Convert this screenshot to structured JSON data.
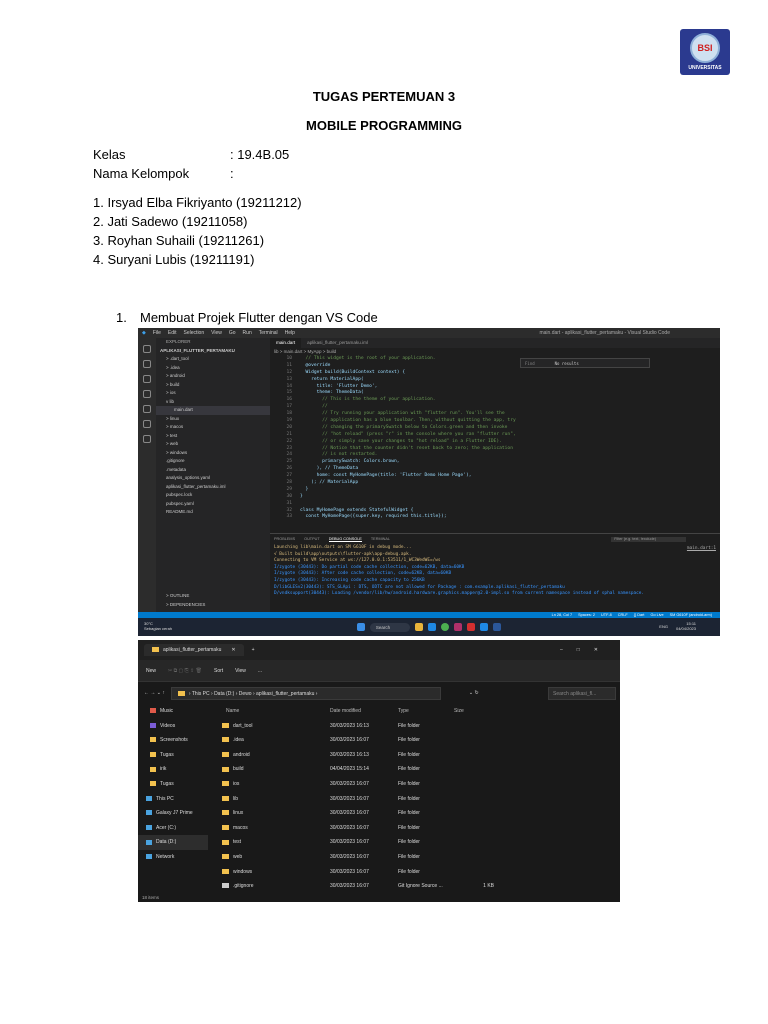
{
  "logo": {
    "text": "UNIVERSITAS",
    "seal": "BSI"
  },
  "header": {
    "title": "TUGAS PERTEMUAN 3",
    "subtitle": "MOBILE PROGRAMMING"
  },
  "info": {
    "kelas_label": "Kelas",
    "kelas_value": ": 19.4B.05",
    "nama_label": "Nama Kelompok",
    "nama_value": ":"
  },
  "members": [
    "1. Irsyad Elba Fikriyanto (19211212)",
    "2. Jati Sadewo (19211058)",
    "3. Royhan Suhaili (19211261)",
    "4. Suryani Lubis (19211191)"
  ],
  "section": {
    "number": "1.",
    "title": "Membuat Projek Flutter dengan VS Code"
  },
  "vscode": {
    "menu": [
      "File",
      "Edit",
      "Selection",
      "View",
      "Go",
      "Run",
      "Terminal",
      "Help"
    ],
    "window_title": "main.dart - aplikasi_flutter_pertamaku - Visual Studio Code",
    "explorer_label": "EXPLORER",
    "project": "APLIKASI_FLUTTER_PERTAMAKU",
    "tree": [
      "> .dart_tool",
      "> .idea",
      "> android",
      "> build",
      "> ios",
      "v lib",
      "main.dart",
      "> linux",
      "> macos",
      "> test",
      "> web",
      "> windows",
      ".gitignore",
      ".metadata",
      "analysis_options.yaml",
      "aplikasi_flutter_pertamaku.iml",
      "pubspec.lock",
      "pubspec.yaml",
      "README.md"
    ],
    "outline": [
      "> OUTLINE",
      "> DEPENDENCIES"
    ],
    "tabs": [
      "main.dart",
      "aplikasi_flutter_pertamaku.iml"
    ],
    "breadcrumb": "lib > main.dart > MyApp > build",
    "find_placeholder": "Find",
    "find_result": "No results",
    "code": [
      {
        "n": "10",
        "t": "  // This widget is the root of your application."
      },
      {
        "n": "11",
        "t": "  @override"
      },
      {
        "n": "12",
        "t": "  Widget build(BuildContext context) {"
      },
      {
        "n": "13",
        "t": "    return MaterialApp("
      },
      {
        "n": "14",
        "t": "      title: 'Flutter Demo',"
      },
      {
        "n": "15",
        "t": "      theme: ThemeData("
      },
      {
        "n": "16",
        "t": "        // This is the theme of your application."
      },
      {
        "n": "17",
        "t": "        //"
      },
      {
        "n": "18",
        "t": "        // Try running your application with \"flutter run\". You'll see the"
      },
      {
        "n": "19",
        "t": "        // application has a blue toolbar. Then, without quitting the app, try"
      },
      {
        "n": "20",
        "t": "        // changing the primarySwatch below to Colors.green and then invoke"
      },
      {
        "n": "21",
        "t": "        // \"hot reload\" (press \"r\" in the console where you ran \"flutter run\","
      },
      {
        "n": "22",
        "t": "        // or simply save your changes to \"hot reload\" in a Flutter IDE)."
      },
      {
        "n": "23",
        "t": "        // Notice that the counter didn't reset back to zero; the application"
      },
      {
        "n": "24",
        "t": "        // is not restarted."
      },
      {
        "n": "25",
        "t": "        primarySwatch: Colors.brown,"
      },
      {
        "n": "26",
        "t": "      ), // ThemeData"
      },
      {
        "n": "27",
        "t": "      home: const MyHomePage(title: 'Flutter Demo Home Page'),"
      },
      {
        "n": "28",
        "t": "    ); // MaterialApp"
      },
      {
        "n": "29",
        "t": "  }"
      },
      {
        "n": "30",
        "t": "}"
      },
      {
        "n": "31",
        "t": ""
      },
      {
        "n": "32",
        "t": "class MyHomePage extends StatefulWidget {"
      },
      {
        "n": "33",
        "t": "  const MyHomePage({super.key, required this.title});"
      }
    ],
    "panel_tabs": [
      "PROBLEMS",
      "OUTPUT",
      "DEBUG CONSOLE",
      "TERMINAL"
    ],
    "filter_placeholder": "Filter (e.g. text, !exclude)",
    "console_link": "main.dart:1",
    "console": [
      "Launching lib\\main.dart on SM G610F in debug mode...",
      "√  Built build\\app\\outputs\\flutter-apk\\app-debug.apk.",
      "Connecting to VM Service at ws://127.0.0.1:53511/1_WC3WedWE=/ws",
      "I/zygote  (30443): Do partial code cache collection, code=62KB, data=60KB",
      "I/zygote  (30443): After code cache collection, code=62KB, data=60KB",
      "I/zygote  (30443): Increasing code cache capacity to 256KB",
      "D/libGLESv2(30443): STS_GLApi : DTS, ODTC are not allowed for Package : com.example.aplikasi_flutter_pertamaku",
      "D/vndksupport(30443): Loading /vendor/lib/hw/android.hardware.graphics.mapper@2.0-impl.so from current namespace instead of sphal namespace."
    ],
    "status": [
      "Ln 28, Col 7",
      "Spaces: 2",
      "UTF-8",
      "CRLF",
      "{} Dart",
      "Go Live",
      "SM G610F (android-arm)"
    ],
    "taskbar": {
      "weather": "30°C",
      "weather_sub": "Sebagian cerah",
      "search": "Search",
      "lang": "ENG",
      "time": "15:11",
      "date": "04/04/2023"
    }
  },
  "file_explorer": {
    "tab": "aplikasi_flutter_pertamaku",
    "toolbar": [
      "New",
      "Sort",
      "View",
      "..."
    ],
    "path": [
      "This PC",
      "Data (D:)",
      "Dewo",
      "aplikasi_flutter_pertamaku"
    ],
    "search_placeholder": "Search aplikasi_fl...",
    "nav": [
      "Music",
      "Videos",
      "Screenshots",
      "Tugas",
      "irik",
      "Tugas",
      "This PC",
      "Galaxy J7 Prime",
      "Acer (C:)",
      "Data (D:)",
      "Network"
    ],
    "columns": [
      "Name",
      "Date modified",
      "Type",
      "Size"
    ],
    "rows": [
      [
        "dart_tool",
        "30/03/2023 16:13",
        "File folder",
        ""
      ],
      [
        ".idea",
        "30/03/2023 16:07",
        "File folder",
        ""
      ],
      [
        "android",
        "30/03/2023 16:13",
        "File folder",
        ""
      ],
      [
        "build",
        "04/04/2023 15:14",
        "File folder",
        ""
      ],
      [
        "ios",
        "30/03/2023 16:07",
        "File folder",
        ""
      ],
      [
        "lib",
        "30/03/2023 16:07",
        "File folder",
        ""
      ],
      [
        "linux",
        "30/03/2023 16:07",
        "File folder",
        ""
      ],
      [
        "macos",
        "30/03/2023 16:07",
        "File folder",
        ""
      ],
      [
        "test",
        "30/03/2023 16:07",
        "File folder",
        ""
      ],
      [
        "web",
        "30/03/2023 16:07",
        "File folder",
        ""
      ],
      [
        "windows",
        "30/03/2023 16:07",
        "File folder",
        ""
      ],
      [
        ".gitignore",
        "30/03/2023 16:07",
        "Git Ignore Source ...",
        "1 KB"
      ]
    ],
    "count": "18 items"
  }
}
